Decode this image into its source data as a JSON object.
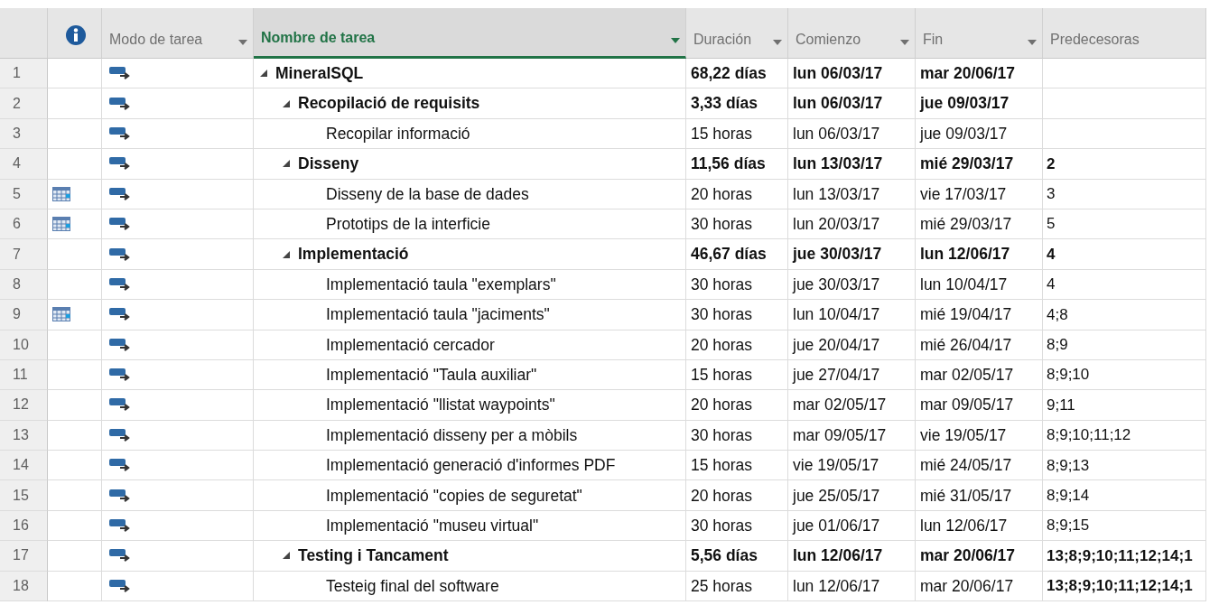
{
  "columns": [
    {
      "kind": "rownum",
      "filter": false,
      "selected": false
    },
    {
      "kind": "info",
      "filter": false,
      "selected": false
    },
    {
      "label": "Modo de tarea",
      "kind": "text",
      "filter": true,
      "selected": false
    },
    {
      "label": "Nombre de tarea",
      "kind": "text",
      "filter": true,
      "selected": true
    },
    {
      "label": "Duración",
      "kind": "text",
      "filter": true,
      "selected": false
    },
    {
      "label": "Comienzo",
      "kind": "text",
      "filter": true,
      "selected": false
    },
    {
      "label": "Fin",
      "kind": "text",
      "filter": true,
      "selected": false
    },
    {
      "label": "Predecesoras",
      "kind": "text",
      "filter": false,
      "selected": false
    }
  ],
  "tasks": [
    {
      "id": "1",
      "calendar": false,
      "name": "MineralSQL",
      "summary": true,
      "expanded": true,
      "duration": "68,22 días",
      "start": "lun 06/03/17",
      "finish": "mar 20/06/17",
      "children": [
        {
          "id": "2",
          "calendar": false,
          "name": "Recopilació de requisits",
          "summary": true,
          "expanded": true,
          "duration": "3,33 días",
          "start": "lun 06/03/17",
          "finish": "jue 09/03/17",
          "children": [
            {
              "id": "3",
              "calendar": false,
              "name": "Recopilar informació",
              "summary": false,
              "duration": "15 horas",
              "start": "lun 06/03/17",
              "finish": "jue 09/03/17"
            }
          ]
        },
        {
          "id": "4",
          "calendar": false,
          "name": "Disseny",
          "summary": true,
          "expanded": true,
          "duration": "11,56 días",
          "start": "lun 13/03/17",
          "finish": "mié 29/03/17",
          "predecessors": "2",
          "predecessors_bold": true,
          "children": [
            {
              "id": "5",
              "calendar": true,
              "name": "Disseny de la base de dades",
              "summary": false,
              "duration": "20 horas",
              "start": "lun 13/03/17",
              "finish": "vie 17/03/17",
              "predecessors": "3",
              "predecessors_bold": false
            },
            {
              "id": "6",
              "calendar": true,
              "name": "Prototips de la interficie",
              "summary": false,
              "duration": "30 horas",
              "start": "lun 20/03/17",
              "finish": "mié 29/03/17",
              "predecessors": "5",
              "predecessors_bold": false
            }
          ]
        },
        {
          "id": "7",
          "calendar": false,
          "name": "Implementació",
          "summary": true,
          "expanded": true,
          "duration": "46,67 días",
          "start": "jue 30/03/17",
          "finish": "lun 12/06/17",
          "predecessors": "4",
          "predecessors_bold": true,
          "children": [
            {
              "id": "8",
              "calendar": false,
              "name": "Implementació taula \"exemplars\"",
              "summary": false,
              "duration": "30 horas",
              "start": "jue 30/03/17",
              "finish": "lun 10/04/17",
              "predecessors": "4",
              "predecessors_bold": false
            },
            {
              "id": "9",
              "calendar": true,
              "name": "Implementació taula \"jaciments\"",
              "summary": false,
              "duration": "30 horas",
              "start": "lun 10/04/17",
              "finish": "mié 19/04/17",
              "predecessors": "4;8",
              "predecessors_bold": false
            },
            {
              "id": "10",
              "calendar": false,
              "name": "Implementació cercador",
              "summary": false,
              "duration": "20 horas",
              "start": "jue 20/04/17",
              "finish": "mié 26/04/17",
              "predecessors": "8;9",
              "predecessors_bold": false
            },
            {
              "id": "11",
              "calendar": false,
              "name": "Implementació \"Taula auxiliar\"",
              "summary": false,
              "duration": "15 horas",
              "start": "jue 27/04/17",
              "finish": "mar 02/05/17",
              "predecessors": "8;9;10",
              "predecessors_bold": false
            },
            {
              "id": "12",
              "calendar": false,
              "name": "Implementació \"llistat waypoints\"",
              "summary": false,
              "duration": "20 horas",
              "start": "mar 02/05/17",
              "finish": "mar 09/05/17",
              "predecessors": "9;11",
              "predecessors_bold": false
            },
            {
              "id": "13",
              "calendar": false,
              "name": "Implementació disseny per a mòbils",
              "summary": false,
              "duration": "30 horas",
              "start": "mar 09/05/17",
              "finish": "vie 19/05/17",
              "predecessors": "8;9;10;11;12",
              "predecessors_bold": false
            },
            {
              "id": "14",
              "calendar": false,
              "name": "Implementació generació d'informes PDF",
              "summary": false,
              "duration": "15 horas",
              "start": "vie 19/05/17",
              "finish": "mié 24/05/17",
              "predecessors": "8;9;13",
              "predecessors_bold": false
            },
            {
              "id": "15",
              "calendar": false,
              "name": "Implementació \"copies de seguretat\"",
              "summary": false,
              "duration": "20 horas",
              "start": "jue 25/05/17",
              "finish": "mié 31/05/17",
              "predecessors": "8;9;14",
              "predecessors_bold": false
            },
            {
              "id": "16",
              "calendar": false,
              "name": "Implementació \"museu virtual\"",
              "summary": false,
              "duration": "30 horas",
              "start": "jue 01/06/17",
              "finish": "lun 12/06/17",
              "predecessors": "8;9;15",
              "predecessors_bold": false
            }
          ]
        },
        {
          "id": "17",
          "calendar": false,
          "name": "Testing i Tancament",
          "summary": true,
          "expanded": true,
          "duration": "5,56 días",
          "start": "lun 12/06/17",
          "finish": "mar 20/06/17",
          "predecessors": "13;8;9;10;11;12;14;1",
          "predecessors_bold": true,
          "children": [
            {
              "id": "18",
              "calendar": false,
              "name": "Testeig final del software",
              "summary": false,
              "duration": "25 horas",
              "start": "lun 12/06/17",
              "finish": "mar 20/06/17",
              "predecessors": "13;8;9;10;11;12;14;1",
              "predecessors_bold": true
            }
          ]
        }
      ]
    }
  ]
}
